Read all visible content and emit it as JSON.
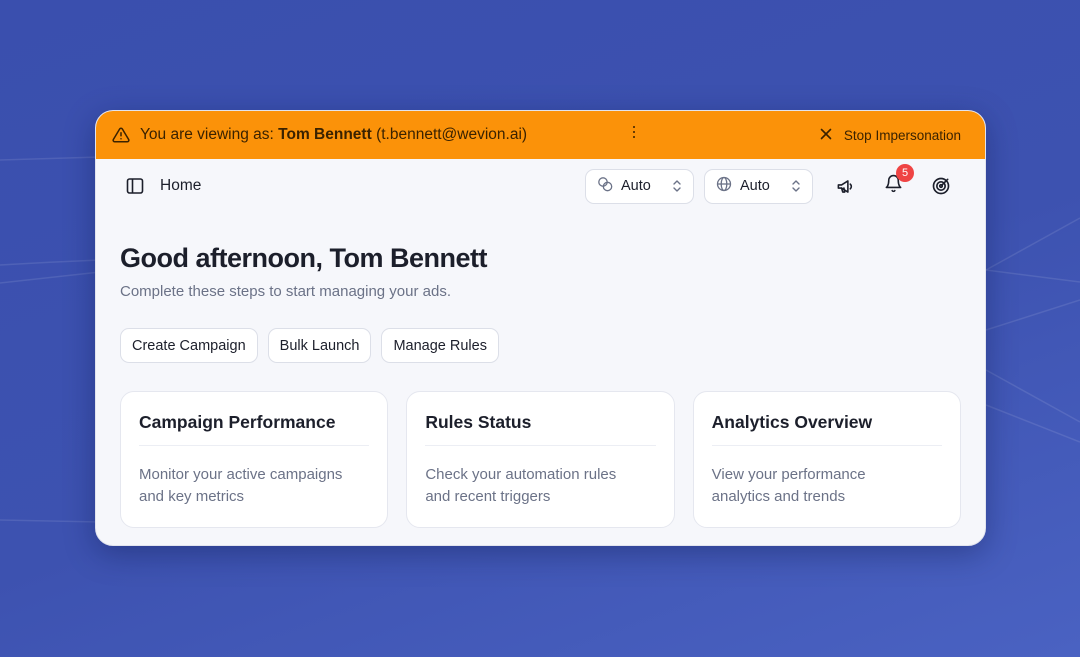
{
  "impersonation": {
    "prefix": "You are viewing as:",
    "name": "Tom Bennett",
    "email": "(t.bennett@wevion.ai)",
    "stop_label": "Stop Impersonation"
  },
  "topbar": {
    "title": "Home",
    "selects": [
      {
        "value": "Auto",
        "icon": "currency-icon"
      },
      {
        "value": "Auto",
        "icon": "globe-icon"
      }
    ],
    "notification_count": "5"
  },
  "main": {
    "greeting": "Good afternoon, Tom Bennett",
    "subtitle": "Complete these steps to start managing your ads.",
    "actions": [
      "Create Campaign",
      "Bulk Launch",
      "Manage Rules"
    ],
    "cards": [
      {
        "title": "Campaign Performance",
        "desc_line1": "Monitor your active campaigns",
        "desc_line2": "and key metrics"
      },
      {
        "title": "Rules Status",
        "desc_line1": "Check your automation rules",
        "desc_line2": "and recent triggers"
      },
      {
        "title": "Analytics Overview",
        "desc_line1": "View your performance",
        "desc_line2": "analytics and trends"
      }
    ]
  },
  "colors": {
    "background": "#3d52b0",
    "banner": "#fb9209",
    "badge": "#ef4444"
  }
}
